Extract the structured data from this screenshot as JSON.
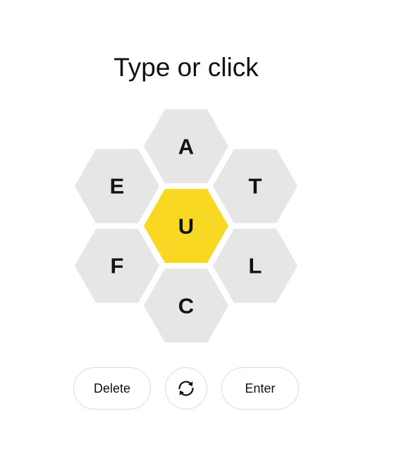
{
  "prompt": "Type or click",
  "hive": {
    "center_letter": "U",
    "outer_letters": [
      "A",
      "T",
      "L",
      "C",
      "F",
      "E"
    ],
    "center_color": "#f8d822",
    "outer_color": "#e6e6e6"
  },
  "controls": {
    "delete_label": "Delete",
    "shuffle_icon": "shuffle-icon",
    "enter_label": "Enter"
  }
}
